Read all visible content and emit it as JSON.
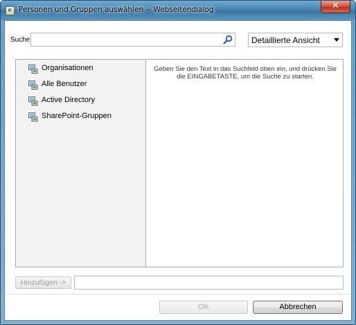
{
  "window": {
    "title": "Personen und Gruppen auswählen -- Webseitendialog",
    "close_glyph": "✕",
    "icon_letter": "e"
  },
  "search": {
    "label": "Suche",
    "value": "",
    "placeholder": ""
  },
  "view": {
    "selected": "Detaillierte Ansicht"
  },
  "tree": {
    "items": [
      {
        "label": "Organisationen",
        "icon": "directory-icon"
      },
      {
        "label": "Alle Benutzer",
        "icon": "directory-icon"
      },
      {
        "label": "Active Directory",
        "icon": "directory-icon"
      },
      {
        "label": "SharePoint-Gruppen",
        "icon": "directory-icon"
      }
    ]
  },
  "results": {
    "hint": "Geben Sie den Text in das Suchfeld oben ein, und drücken Sie die EINGABETASTE, um die Suche zu starten."
  },
  "add": {
    "button_label": "Hinzufügen ->",
    "value": ""
  },
  "footer": {
    "ok_label": "OK",
    "cancel_label": "Abbrechen"
  },
  "colors": {
    "titlebar": "#4a86b3",
    "close_button": "#c74a34",
    "pane_background": "#f2f2f2"
  }
}
